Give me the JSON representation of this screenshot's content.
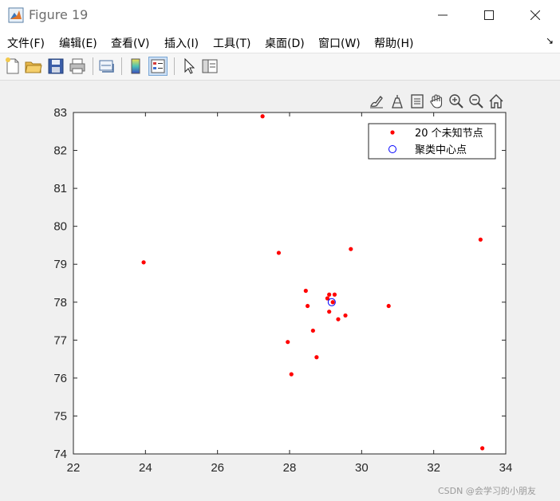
{
  "window": {
    "title": "Figure 19",
    "app_icon": "matlab-icon"
  },
  "menu": {
    "items": [
      "文件(F)",
      "编辑(E)",
      "查看(V)",
      "插入(I)",
      "工具(T)",
      "桌面(D)",
      "窗口(W)",
      "帮助(H)"
    ],
    "overflow_arrow": "↘"
  },
  "toolbar": {
    "buttons": [
      "new-figure-icon",
      "open-file-icon",
      "save-icon",
      "print-icon",
      "link-plot-icon",
      "colorbar-icon",
      "legend-icon",
      "pointer-icon",
      "property-editor-icon"
    ],
    "active": "legend-icon"
  },
  "axes_toolbar": {
    "buttons": [
      "brush-icon",
      "data-tips-icon",
      "data-cursor-icon",
      "pan-icon",
      "zoom-in-icon",
      "zoom-out-icon",
      "home-icon"
    ]
  },
  "chart_data": {
    "type": "scatter",
    "xlim": [
      22,
      34
    ],
    "ylim": [
      74,
      83
    ],
    "xticks": [
      "22",
      "24",
      "26",
      "28",
      "30",
      "32",
      "34"
    ],
    "yticks": [
      "74",
      "75",
      "76",
      "77",
      "78",
      "79",
      "80",
      "81",
      "82",
      "83"
    ],
    "grid": false,
    "legend_position": "top-right",
    "series": [
      {
        "name": "20 个未知节点",
        "marker": "dot",
        "color": "#ff0000",
        "x": [
          27.25,
          23.95,
          27.7,
          29.7,
          33.3,
          28.45,
          28.5,
          29.05,
          29.1,
          29.25,
          29.1,
          29.55,
          29.35,
          30.75,
          28.65,
          27.95,
          28.75,
          28.05,
          33.35,
          29.2
        ],
        "y": [
          82.9,
          79.05,
          79.3,
          79.4,
          79.65,
          78.3,
          77.9,
          78.1,
          78.2,
          78.2,
          77.75,
          77.65,
          77.55,
          77.9,
          77.25,
          76.95,
          76.55,
          76.1,
          74.15,
          78.0
        ]
      },
      {
        "name": "聚类中心点",
        "marker": "circle",
        "color": "#0000ff",
        "x": [
          29.17
        ],
        "y": [
          78.0
        ]
      }
    ]
  },
  "watermark": "CSDN @会学习的小朋友"
}
